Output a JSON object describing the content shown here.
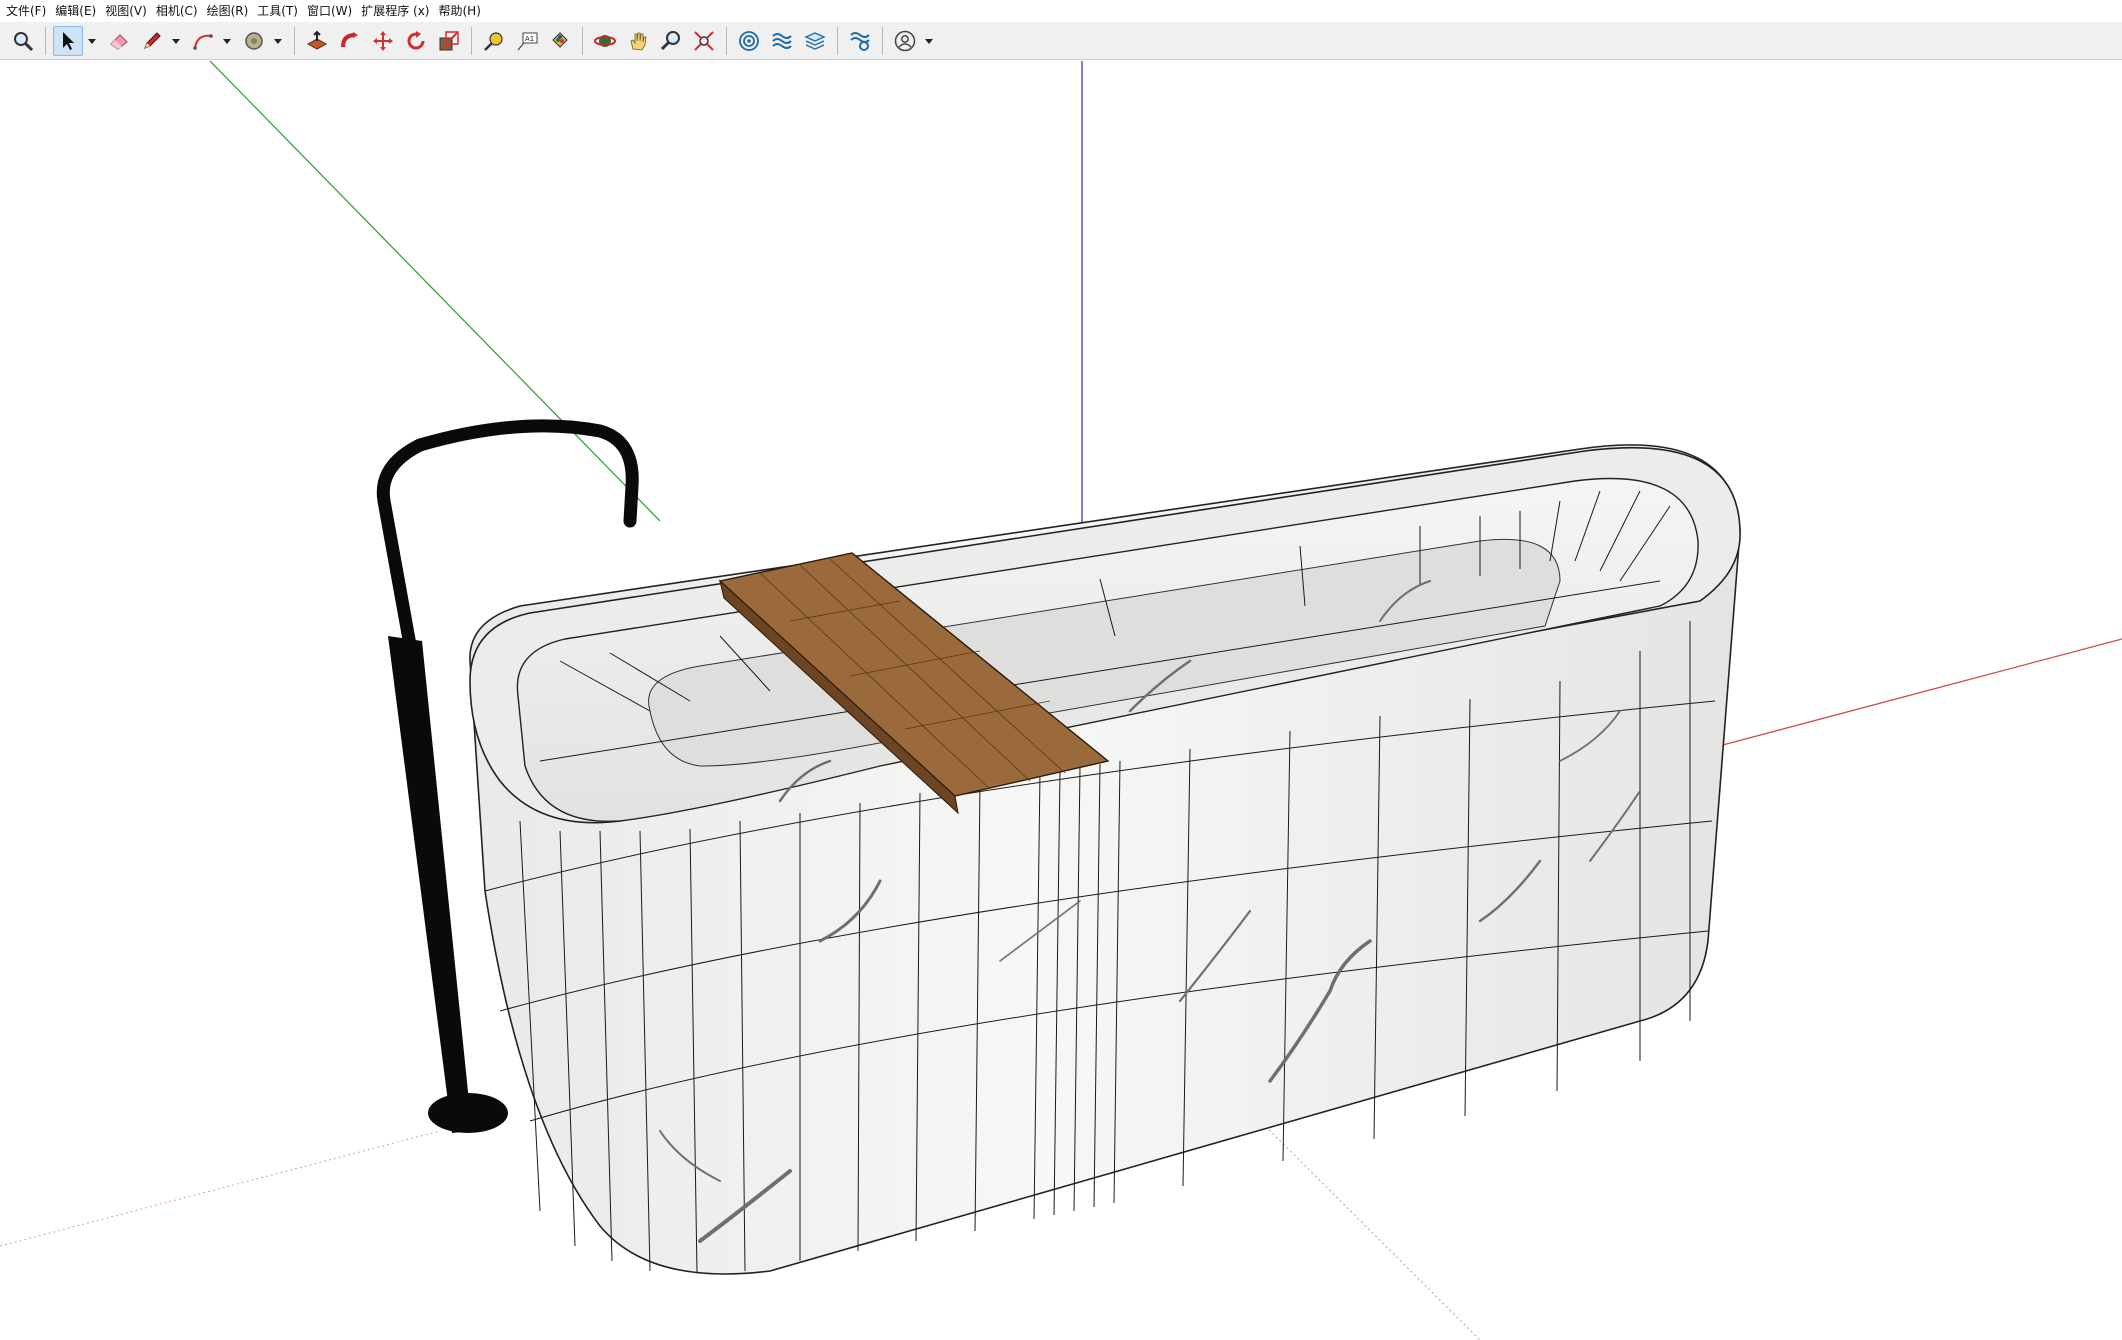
{
  "menu": {
    "items": [
      {
        "label": "文件(F)"
      },
      {
        "label": "编辑(E)"
      },
      {
        "label": "视图(V)"
      },
      {
        "label": "相机(C)"
      },
      {
        "label": "绘图(R)"
      },
      {
        "label": "工具(T)"
      },
      {
        "label": "窗口(W)"
      },
      {
        "label": "扩展程序 (x)"
      },
      {
        "label": "帮助(H)"
      }
    ]
  },
  "toolbar": {
    "tools": [
      {
        "name": "zoom-tool",
        "icon": "magnifier-icon"
      },
      {
        "name": "select-tool",
        "icon": "arrow-cursor-icon",
        "active": true
      },
      {
        "name": "eraser-tool",
        "icon": "eraser-icon"
      },
      {
        "name": "pencil-tool",
        "icon": "pencil-icon"
      },
      {
        "name": "arc-tool",
        "icon": "arc-icon"
      },
      {
        "name": "shape-tool",
        "icon": "circle-shape-icon"
      },
      {
        "name": "push-pull-tool",
        "icon": "push-pull-icon"
      },
      {
        "name": "follow-me-tool",
        "icon": "follow-me-icon"
      },
      {
        "name": "move-tool",
        "icon": "move-cross-icon"
      },
      {
        "name": "rotate-tool",
        "icon": "rotate-icon"
      },
      {
        "name": "scale-tool",
        "icon": "scale-icon"
      },
      {
        "name": "tape-measure-tool",
        "icon": "tape-measure-icon"
      },
      {
        "name": "text-tool",
        "icon": "text-label-icon"
      },
      {
        "name": "paint-bucket-tool",
        "icon": "paint-bucket-icon"
      },
      {
        "name": "orbit-tool",
        "icon": "orbit-icon"
      },
      {
        "name": "pan-tool",
        "icon": "hand-icon"
      },
      {
        "name": "zoom-window-tool",
        "icon": "zoom-search-icon"
      },
      {
        "name": "zoom-extents-tool",
        "icon": "zoom-extents-icon"
      },
      {
        "name": "model-info-tool",
        "icon": "target-icon"
      },
      {
        "name": "sandbox-tool",
        "icon": "waves-icon"
      },
      {
        "name": "layers-tool",
        "icon": "layers-icon"
      },
      {
        "name": "styles-tool",
        "icon": "waves-gear-icon"
      },
      {
        "name": "account-tool",
        "icon": "user-circle-icon"
      }
    ]
  },
  "colors": {
    "axis_red": "#d14a4a",
    "axis_green": "#3aa33a",
    "axis_blue": "#3b3bbf",
    "marble": "#f1f1ef",
    "marble_vein": "#6f6f6f",
    "wood": "#9b6a3c",
    "faucet": "#0a0a0a"
  }
}
